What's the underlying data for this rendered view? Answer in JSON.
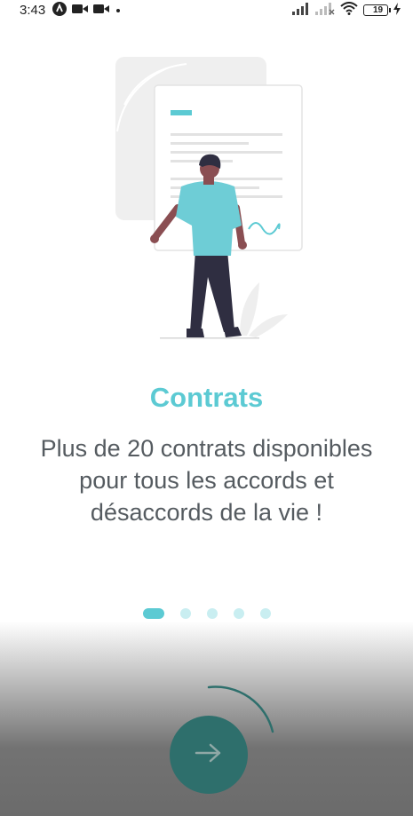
{
  "status_bar": {
    "time": "3:43",
    "left_icons": [
      "assistant-icon",
      "video-icon",
      "video-icon",
      "dot-icon"
    ],
    "battery_level": "19"
  },
  "onboarding": {
    "title": "Contrats",
    "description": "Plus de 20 contrats disponibles pour tous les accords et désaccords de la vie !",
    "pages_total": 5,
    "current_page": 1
  },
  "next_button": {
    "icon": "arrow-right-icon"
  },
  "colors": {
    "accent": "#5ccad3",
    "text_secondary": "#555b60",
    "dot_inactive": "#c9eef1",
    "button": "#2e6f6c"
  }
}
